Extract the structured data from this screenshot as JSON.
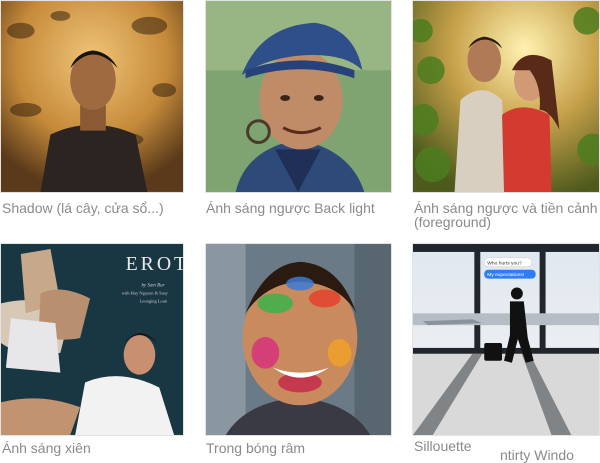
{
  "gallery": {
    "items": [
      {
        "caption": "Shadow (lá cây, cửa sổ...)",
        "icon": "photo-shadow-leaves"
      },
      {
        "caption": "Ánh sáng ngược Back light",
        "icon": "photo-backlight-portrait"
      },
      {
        "caption": "Ánh sáng ngược và tiền cảnh (foreground)",
        "icon": "photo-backlight-foreground"
      },
      {
        "caption": "Ánh sáng xiên",
        "icon": "photo-oblique-light"
      },
      {
        "caption": "Trong bóng râm",
        "icon": "photo-in-shade"
      },
      {
        "caption": "Sillouette",
        "icon": "photo-silhouette"
      }
    ],
    "cut_off_text": "ntirty Windo",
    "book_cover": {
      "title": "EROT",
      "byline": "by Sam Bur",
      "credit": "with Huy Nguyen & Susy",
      "subtitle": "Lounging Loun"
    },
    "phone_bubbles": [
      "Who hurts you?",
      "My expectations!"
    ]
  }
}
